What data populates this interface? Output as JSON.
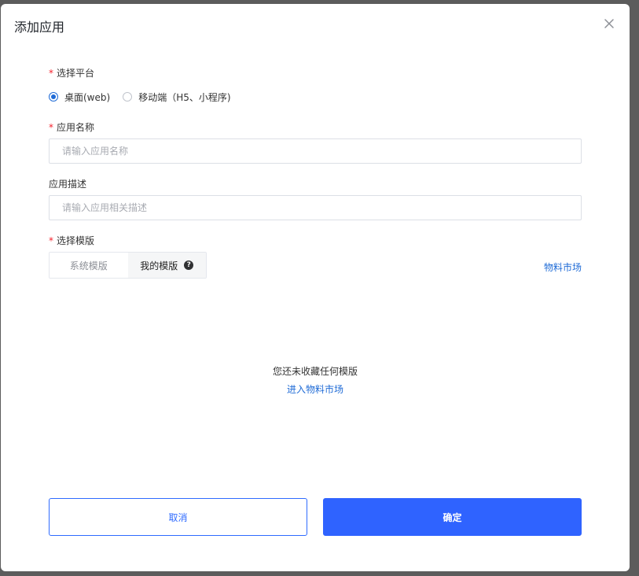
{
  "dialog": {
    "title": "添加应用",
    "close_icon": "close-icon"
  },
  "platform": {
    "label": "选择平台",
    "required_mark": "*",
    "options": [
      {
        "label": "桌面(web)",
        "checked": true
      },
      {
        "label": "移动端（H5、小程序)",
        "checked": false
      }
    ]
  },
  "app_name": {
    "label": "应用名称",
    "required_mark": "*",
    "value": "",
    "placeholder": "请输入应用名称"
  },
  "app_desc": {
    "label": "应用描述",
    "value": "",
    "placeholder": "请输入应用相关描述"
  },
  "template": {
    "label": "选择模版",
    "required_mark": "*",
    "tabs": [
      {
        "label": "系统模版",
        "active": false
      },
      {
        "label": "我的模版",
        "active": true
      }
    ],
    "help_icon": "question-circle-icon",
    "help_glyph": "?",
    "market_link": "物料市场"
  },
  "empty_state": {
    "message": "您还未收藏任何模版",
    "link": "进入物料市场"
  },
  "footer": {
    "cancel_label": "取消",
    "ok_label": "确定"
  },
  "colors": {
    "primary": "#2f63ff",
    "link": "#1f6bd6",
    "required": "#f5222d",
    "overlay": "#5c5c5c"
  }
}
